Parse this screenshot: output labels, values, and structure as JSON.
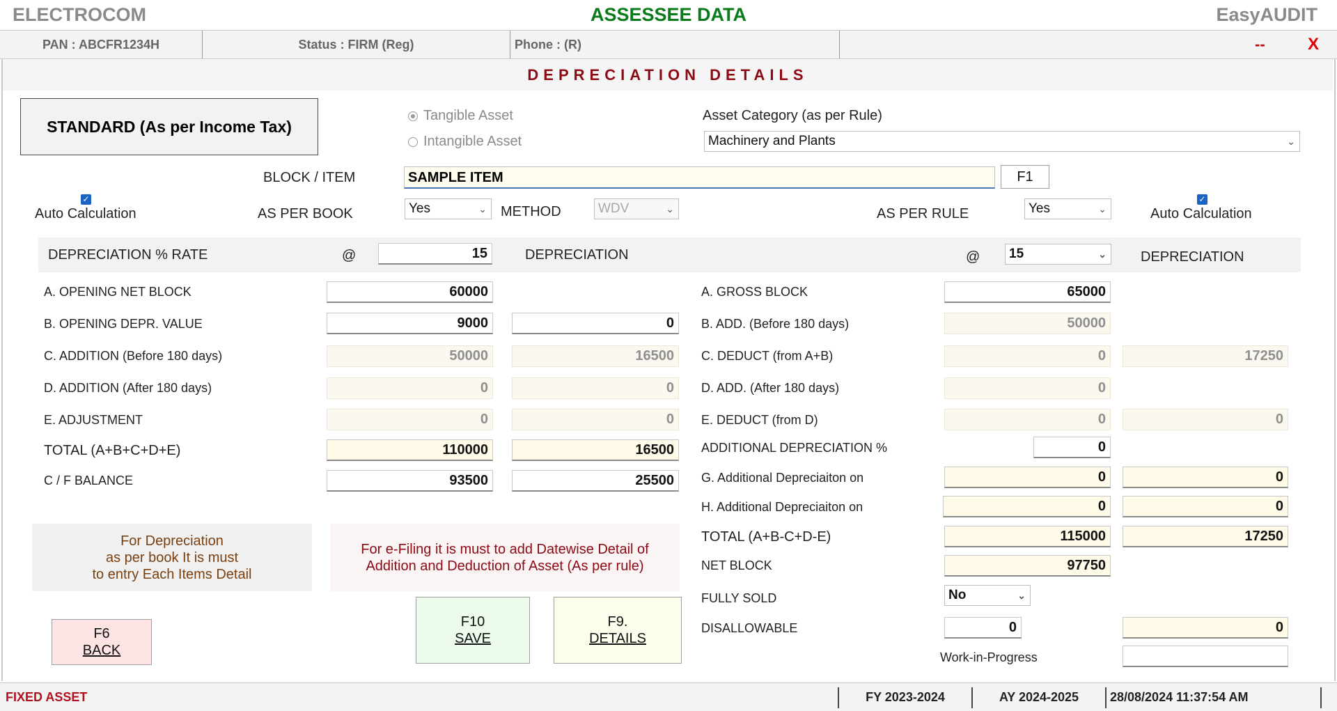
{
  "header": {
    "app_name": "ELECTROCOM",
    "title": "ASSESSEE DATA",
    "brand": "EasyAUDIT"
  },
  "infobar": {
    "pan": "PAN  :  ABCFR1234H",
    "status": "Status  :  FIRM (Reg)",
    "phone": "Phone  : (R)",
    "minimize": "--",
    "close": "X"
  },
  "section_title": "DEPRECIATION DETAILS",
  "standard_button": "STANDARD (As per Income Tax)",
  "asset_type": {
    "tangible": "Tangible Asset",
    "intangible": "Intangible Asset",
    "selected": "tangible"
  },
  "asset_category": {
    "label": "Asset Category (as per Rule)",
    "value": "Machinery and Plants"
  },
  "block_item": {
    "label": "BLOCK / ITEM",
    "value": "SAMPLE ITEM",
    "f1": "F1"
  },
  "book_side": {
    "auto_calc": "Auto Calculation",
    "as_per_label": "AS PER BOOK",
    "as_per_value": "Yes",
    "method_label": "METHOD",
    "method_value": "WDV",
    "rate_label": "DEPRECIATION % RATE",
    "at": "@",
    "rate_value": "15",
    "depr_label": "DEPRECIATION",
    "rows": [
      {
        "label": "A.  OPENING NET BLOCK",
        "value": "60000",
        "depr": ""
      },
      {
        "label": "B.  OPENING DEPR. VALUE",
        "value": "9000",
        "depr": "0"
      },
      {
        "label": "C.  ADDITION (Before 180 days)",
        "value": "50000",
        "depr": "16500"
      },
      {
        "label": "D.  ADDITION (After 180 days)",
        "value": "0",
        "depr": "0"
      },
      {
        "label": "E.  ADJUSTMENT",
        "value": "0",
        "depr": "0"
      },
      {
        "label": "TOTAL (A+B+C+D+E)",
        "value": "110000",
        "depr": "16500"
      },
      {
        "label": "C / F BALANCE",
        "value": "93500",
        "depr": "25500"
      }
    ]
  },
  "rule_side": {
    "auto_calc": "Auto Calculation",
    "as_per_label": "AS PER RULE",
    "as_per_value": "Yes",
    "at": "@",
    "rate_value": "15",
    "depr_label": "DEPRECIATION",
    "rows": [
      {
        "label": "A.  GROSS BLOCK",
        "value": "65000",
        "depr": ""
      },
      {
        "label": "B.  ADD. (Before 180 days)",
        "value": "50000",
        "depr": ""
      },
      {
        "label": "C.  DEDUCT (from A+B)",
        "value": "0",
        "depr": "17250"
      },
      {
        "label": "D.  ADD. (After 180 days)",
        "value": "0",
        "depr": ""
      },
      {
        "label": "E.  DEDUCT (from D)",
        "value": "0",
        "depr": "0"
      }
    ],
    "additional_pct_label": "ADDITIONAL DEPRECIATION %",
    "additional_pct_value": "0",
    "g_label": "G. Additional Depreciaiton on",
    "g_value": "0",
    "g_depr": "0",
    "h_label": "H. Additional Depreciaiton on",
    "h_value": "0",
    "h_depr": "0",
    "total_label": "TOTAL (A+B-C+D-E)",
    "total_value": "115000",
    "total_depr": "17250",
    "net_block_label": "NET BLOCK",
    "net_block_value": "97750",
    "fully_sold_label": "FULLY SOLD",
    "fully_sold_value": "No",
    "disallowable_label": "DISALLOWABLE",
    "disallowable_value": "0",
    "disallowable_depr": "0",
    "wip_label": "Work-in-Progress",
    "wip_value": ""
  },
  "notes": {
    "book_note": "For Depreciation\nas per book  It is must\nto entry Each Items Detail",
    "efiling_note": "For e-Filing it is must to add Datewise Detail of\nAddition and Deduction of Asset (As per rule)"
  },
  "buttons": {
    "back_key": "F6",
    "back_label": "BACK",
    "save_key": "F10",
    "save_label": "SAVE",
    "details_key": "F9.",
    "details_label": "DETAILS"
  },
  "statusbar": {
    "module": "FIXED ASSET",
    "fy": "FY 2023-2024",
    "ay": "AY 2024-2025",
    "datetime": "28/08/2024 11:37:54 AM"
  },
  "colors": {
    "title_green": "#0a7a1a",
    "section_red": "#8b0a14",
    "checkbox_blue": "#1a62c4",
    "back_button_bg": "#fde3e3",
    "save_button_bg": "#ecfbec",
    "details_button_bg": "#fdfdec"
  }
}
